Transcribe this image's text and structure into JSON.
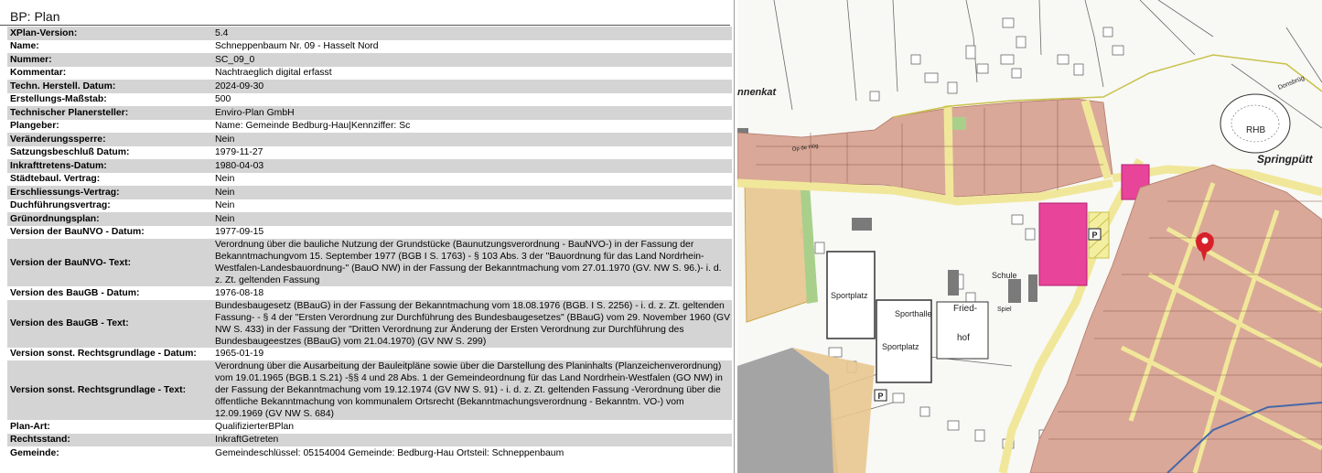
{
  "panel": {
    "title": "BP: Plan",
    "rows": [
      {
        "label": "XPlan-Version:",
        "value": "5.4"
      },
      {
        "label": "Name:",
        "value": "Schneppenbaum Nr. 09 - Hasselt Nord"
      },
      {
        "label": "Nummer:",
        "value": "SC_09_0"
      },
      {
        "label": "Kommentar:",
        "value": "Nachtraeglich digital erfasst"
      },
      {
        "label": "Techn. Herstell. Datum:",
        "value": "2024-09-30"
      },
      {
        "label": "Erstellungs-Maßstab:",
        "value": "500"
      },
      {
        "label": "Technischer Planersteller:",
        "value": "Enviro-Plan GmbH"
      },
      {
        "label": "Plangeber:",
        "value": "Name: Gemeinde Bedburg-Hau|Kennziffer: Sc"
      },
      {
        "label": "Veränderungssperre:",
        "value": "Nein"
      },
      {
        "label": "Satzungsbeschluß Datum:",
        "value": "1979-11-27"
      },
      {
        "label": "Inkrafttretens-Datum:",
        "value": "1980-04-03"
      },
      {
        "label": "Städtebaul. Vertrag:",
        "value": "Nein"
      },
      {
        "label": "Erschliessungs-Vertrag:",
        "value": "Nein"
      },
      {
        "label": "Duchführungsvertrag:",
        "value": "Nein"
      },
      {
        "label": "Grünordnungsplan:",
        "value": "Nein"
      },
      {
        "label": "Version der BauNVO - Datum:",
        "value": "1977-09-15"
      },
      {
        "label": "Version der BauNVO- Text:",
        "value": "Verordnung über die bauliche Nutzung der Grundstücke (Baunutzungsverordnung - BauNVO-) in der Fassung der Bekanntmachungvom 15. September 1977 (BGB I S. 1763) - § 103 Abs. 3 der \"Bauordnung für das Land Nordrhein-Westfalen-Landesbauordnung-\" (BauO NW) in der Fassung der Bekanntmachung vom 27.01.1970 (GV. NW S. 96.)- i. d. z. Zt. geltenden Fassung"
      },
      {
        "label": "Version des BauGB - Datum:",
        "value": "1976-08-18"
      },
      {
        "label": "Version des BauGB - Text:",
        "value": "Bundesbaugesetz (BBauG) in der Fassung der Bekanntmachung vom 18.08.1976 (BGB. I S. 2256) - i. d. z. Zt. geltenden Fassung- - § 4 der \"Ersten Verordnung zur Durchführung des Bundesbaugesetzes\" (BBauG) vom 29. November 1960 (GV NW S. 433) in der Fassung der \"Dritten Verordnung zur Änderung der Ersten Verordnung zur Durchführung des Bundesbaugeestzes (BBauG) vom 21.04.1970) (GV NW S. 299)"
      },
      {
        "label": "Version sonst. Rechtsgrundlage - Datum:",
        "value": "1965-01-19"
      },
      {
        "label": "Version sonst. Rechtsgrundlage - Text:",
        "value": "Verordnung über die Ausarbeitung der Bauleitpläne sowie über die Darstellung des Planinhalts (Planzeichenverordnung) vom 19.01.1965 (BGB.1 S.21) -§§ 4 und 28 Abs. 1 der Gemeindeordnung für das Land Nordrhein-Westfalen (GO NW) in der Fassung der Bekanntmachung vom 19.12.1974 (GV NW S. 91) - i. d. z. Zt. geltenden Fassung -Verordnung über die öffentliche Bekanntmachung von kommunalem Ortsrecht (Bekanntmachungsverordnung - Bekanntm. VO-) vom 12.09.1969 (GV NW S. 684)"
      },
      {
        "label": "Plan-Art:",
        "value": "QualifizierterBPlan"
      },
      {
        "label": "Rechtsstand:",
        "value": "InkraftGetreten"
      },
      {
        "label": "Gemeinde:",
        "value": "Gemeindeschlüssel: 05154004 Gemeinde: Bedburg-Hau Ortsteil: Schneppenbaum"
      }
    ]
  },
  "map": {
    "labels": {
      "nnenkat": "nnenkat",
      "springputt": "Springpütt",
      "rhb": "RHB",
      "sportplatz1": "Sportplatz",
      "sportplatz2": "Sportplatz",
      "sporthalle": "Sporthalle",
      "fried": "Fried-",
      "hof": "hof",
      "schule": "Schule",
      "spiel": "Spiel",
      "parking1": "P",
      "parking2": "P",
      "street_hoge": "Op de Hög",
      "street_donsbr": "Donsbrüg"
    },
    "colors": {
      "residential": "#d9a898",
      "commercial_pink": "#e8449a",
      "mixed_orange": "#e8c790",
      "green": "#a8d08a",
      "road_yellow": "#f4eea0",
      "plan_boundary": "#c9c24a",
      "marker": "#d8202a"
    },
    "icons": {
      "marker": "map-pin-icon",
      "parking": "parking-icon"
    }
  }
}
